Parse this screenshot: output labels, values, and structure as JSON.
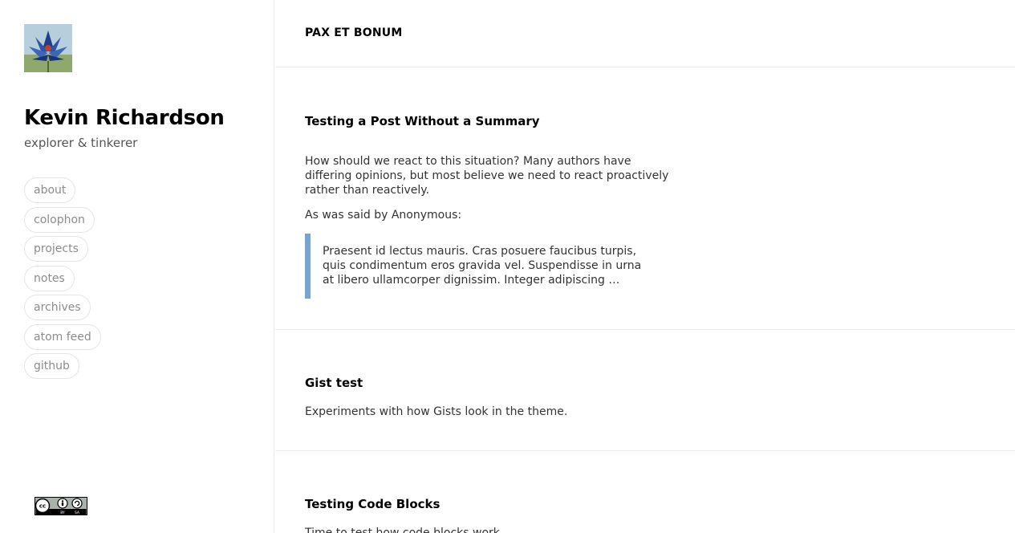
{
  "sidebar": {
    "avatar_alt": "blue lotus flower avatar",
    "title": "Kevin Richardson",
    "tagline": "explorer & tinkerer",
    "nav": [
      {
        "label": "about"
      },
      {
        "label": "colophon"
      },
      {
        "label": "projects"
      },
      {
        "label": "notes"
      },
      {
        "label": "archives"
      },
      {
        "label": "atom feed"
      },
      {
        "label": "github"
      }
    ],
    "license_badge": "CC BY SA"
  },
  "header": {
    "blog_name": "PAX ET BONUM"
  },
  "posts": [
    {
      "title": "Testing a Post Without a Summary",
      "paragraph1": "How should we react to this situation? Many authors have differing opinions, but most believe we need to react proactively rather than reactively.",
      "paragraph2": "As was said by Anonymous:",
      "quote": "Praesent id lectus mauris. Cras posuere faucibus turpis, quis condimentum eros gravida vel. Suspendisse in urna at libero ullamcorper dignissim. Integer adipiscing …"
    },
    {
      "title": "Gist test",
      "paragraph1": "Experiments with how Gists look in the theme."
    },
    {
      "title": "Testing Code Blocks",
      "paragraph1": "Time to test how code blocks work."
    }
  ],
  "colors": {
    "quote_border": "#7aa3cf",
    "nav_text": "#8c8c8c",
    "divider": "#ebebeb"
  }
}
